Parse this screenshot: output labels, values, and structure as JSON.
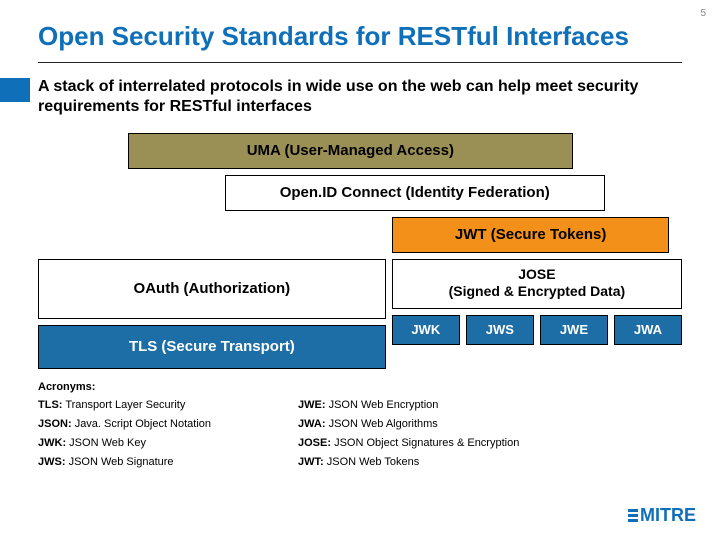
{
  "page_number": "5",
  "title": "Open Security Standards for RESTful Interfaces",
  "lead": "A stack of interrelated protocols in wide use on the web can help meet security requirements for RESTful interfaces",
  "diagram": {
    "uma": "UMA (User-Managed Access)",
    "oidc": "Open.ID Connect (Identity Federation)",
    "jwt": "JWT (Secure Tokens)",
    "oauth": "OAuth (Authorization)",
    "tls": "TLS (Secure Transport)",
    "jose_title": "JOSE",
    "jose_sub": "(Signed & Encrypted Data)",
    "jose_children": {
      "jwk": "JWK",
      "jws": "JWS",
      "jwe": "JWE",
      "jwa": "JWA"
    }
  },
  "acronyms": {
    "heading": "Acronyms:",
    "items": {
      "tls": {
        "abbr": "TLS:",
        "full": "Transport Layer Security"
      },
      "jwe": {
        "abbr": "JWE:",
        "full": "JSON Web Encryption"
      },
      "json": {
        "abbr": "JSON:",
        "full": "Java. Script Object Notation"
      },
      "jwa": {
        "abbr": "JWA:",
        "full": "JSON Web Algorithms"
      },
      "jwk": {
        "abbr": "JWK:",
        "full": "JSON Web Key"
      },
      "jose": {
        "abbr": "JOSE:",
        "full": "JSON Object Signatures & Encryption"
      },
      "jws": {
        "abbr": "JWS:",
        "full": "JSON Web Signature"
      },
      "jwt": {
        "abbr": "JWT:",
        "full": "JSON Web Tokens"
      }
    }
  },
  "logo_text": "MITRE"
}
